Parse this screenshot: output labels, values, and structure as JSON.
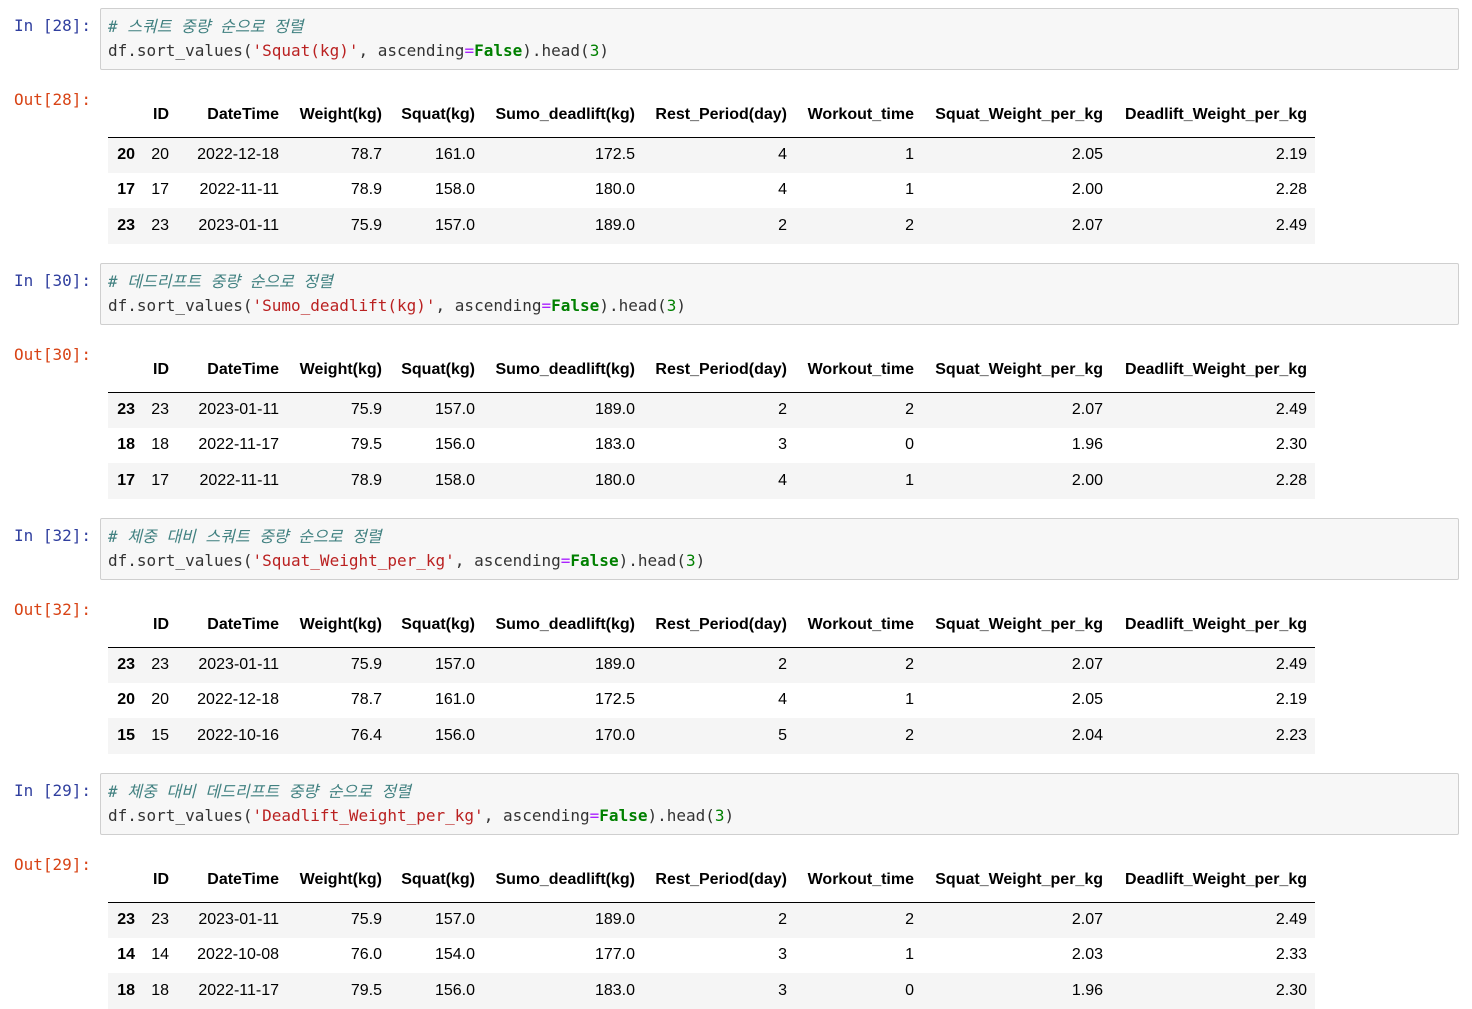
{
  "columns": [
    "",
    "ID",
    "DateTime",
    "Weight(kg)",
    "Squat(kg)",
    "Sumo_deadlift(kg)",
    "Rest_Period(day)",
    "Workout_time",
    "Squat_Weight_per_kg",
    "Deadlift_Weight_per_kg"
  ],
  "cells": [
    {
      "in_prompt": "In [28]:",
      "out_prompt": "Out[28]:",
      "comment": "# 스쿼트 중량 순으로 정렬",
      "code": {
        "pre": "df.sort_values(",
        "arg": "'Squat(kg)'",
        "mid": ", ascending",
        "eq": "=",
        "kw": "False",
        "post1": ").head(",
        "num": "3",
        "post2": ")"
      },
      "rows": [
        [
          "20",
          "20",
          "2022-12-18",
          "78.7",
          "161.0",
          "172.5",
          "4",
          "1",
          "2.05",
          "2.19"
        ],
        [
          "17",
          "17",
          "2022-11-11",
          "78.9",
          "158.0",
          "180.0",
          "4",
          "1",
          "2.00",
          "2.28"
        ],
        [
          "23",
          "23",
          "2023-01-11",
          "75.9",
          "157.0",
          "189.0",
          "2",
          "2",
          "2.07",
          "2.49"
        ]
      ]
    },
    {
      "in_prompt": "In [30]:",
      "out_prompt": "Out[30]:",
      "comment": "# 데드리프트 중량 순으로 정렬",
      "code": {
        "pre": "df.sort_values(",
        "arg": "'Sumo_deadlift(kg)'",
        "mid": ", ascending",
        "eq": "=",
        "kw": "False",
        "post1": ").head(",
        "num": "3",
        "post2": ")"
      },
      "rows": [
        [
          "23",
          "23",
          "2023-01-11",
          "75.9",
          "157.0",
          "189.0",
          "2",
          "2",
          "2.07",
          "2.49"
        ],
        [
          "18",
          "18",
          "2022-11-17",
          "79.5",
          "156.0",
          "183.0",
          "3",
          "0",
          "1.96",
          "2.30"
        ],
        [
          "17",
          "17",
          "2022-11-11",
          "78.9",
          "158.0",
          "180.0",
          "4",
          "1",
          "2.00",
          "2.28"
        ]
      ]
    },
    {
      "in_prompt": "In [32]:",
      "out_prompt": "Out[32]:",
      "comment": "# 체중 대비 스쿼트 중량 순으로 정렬",
      "code": {
        "pre": "df.sort_values(",
        "arg": "'Squat_Weight_per_kg'",
        "mid": ", ascending",
        "eq": "=",
        "kw": "False",
        "post1": ").head(",
        "num": "3",
        "post2": ")"
      },
      "rows": [
        [
          "23",
          "23",
          "2023-01-11",
          "75.9",
          "157.0",
          "189.0",
          "2",
          "2",
          "2.07",
          "2.49"
        ],
        [
          "20",
          "20",
          "2022-12-18",
          "78.7",
          "161.0",
          "172.5",
          "4",
          "1",
          "2.05",
          "2.19"
        ],
        [
          "15",
          "15",
          "2022-10-16",
          "76.4",
          "156.0",
          "170.0",
          "5",
          "2",
          "2.04",
          "2.23"
        ]
      ]
    },
    {
      "in_prompt": "In [29]:",
      "out_prompt": "Out[29]:",
      "comment": "# 체중 대비 데드리프트 중량 순으로 정렬",
      "code": {
        "pre": "df.sort_values(",
        "arg": "'Deadlift_Weight_per_kg'",
        "mid": ", ascending",
        "eq": "=",
        "kw": "False",
        "post1": ").head(",
        "num": "3",
        "post2": ")"
      },
      "rows": [
        [
          "23",
          "23",
          "2023-01-11",
          "75.9",
          "157.0",
          "189.0",
          "2",
          "2",
          "2.07",
          "2.49"
        ],
        [
          "14",
          "14",
          "2022-10-08",
          "76.0",
          "154.0",
          "177.0",
          "3",
          "1",
          "2.03",
          "2.33"
        ],
        [
          "18",
          "18",
          "2022-11-17",
          "79.5",
          "156.0",
          "183.0",
          "3",
          "0",
          "1.96",
          "2.30"
        ]
      ]
    }
  ]
}
